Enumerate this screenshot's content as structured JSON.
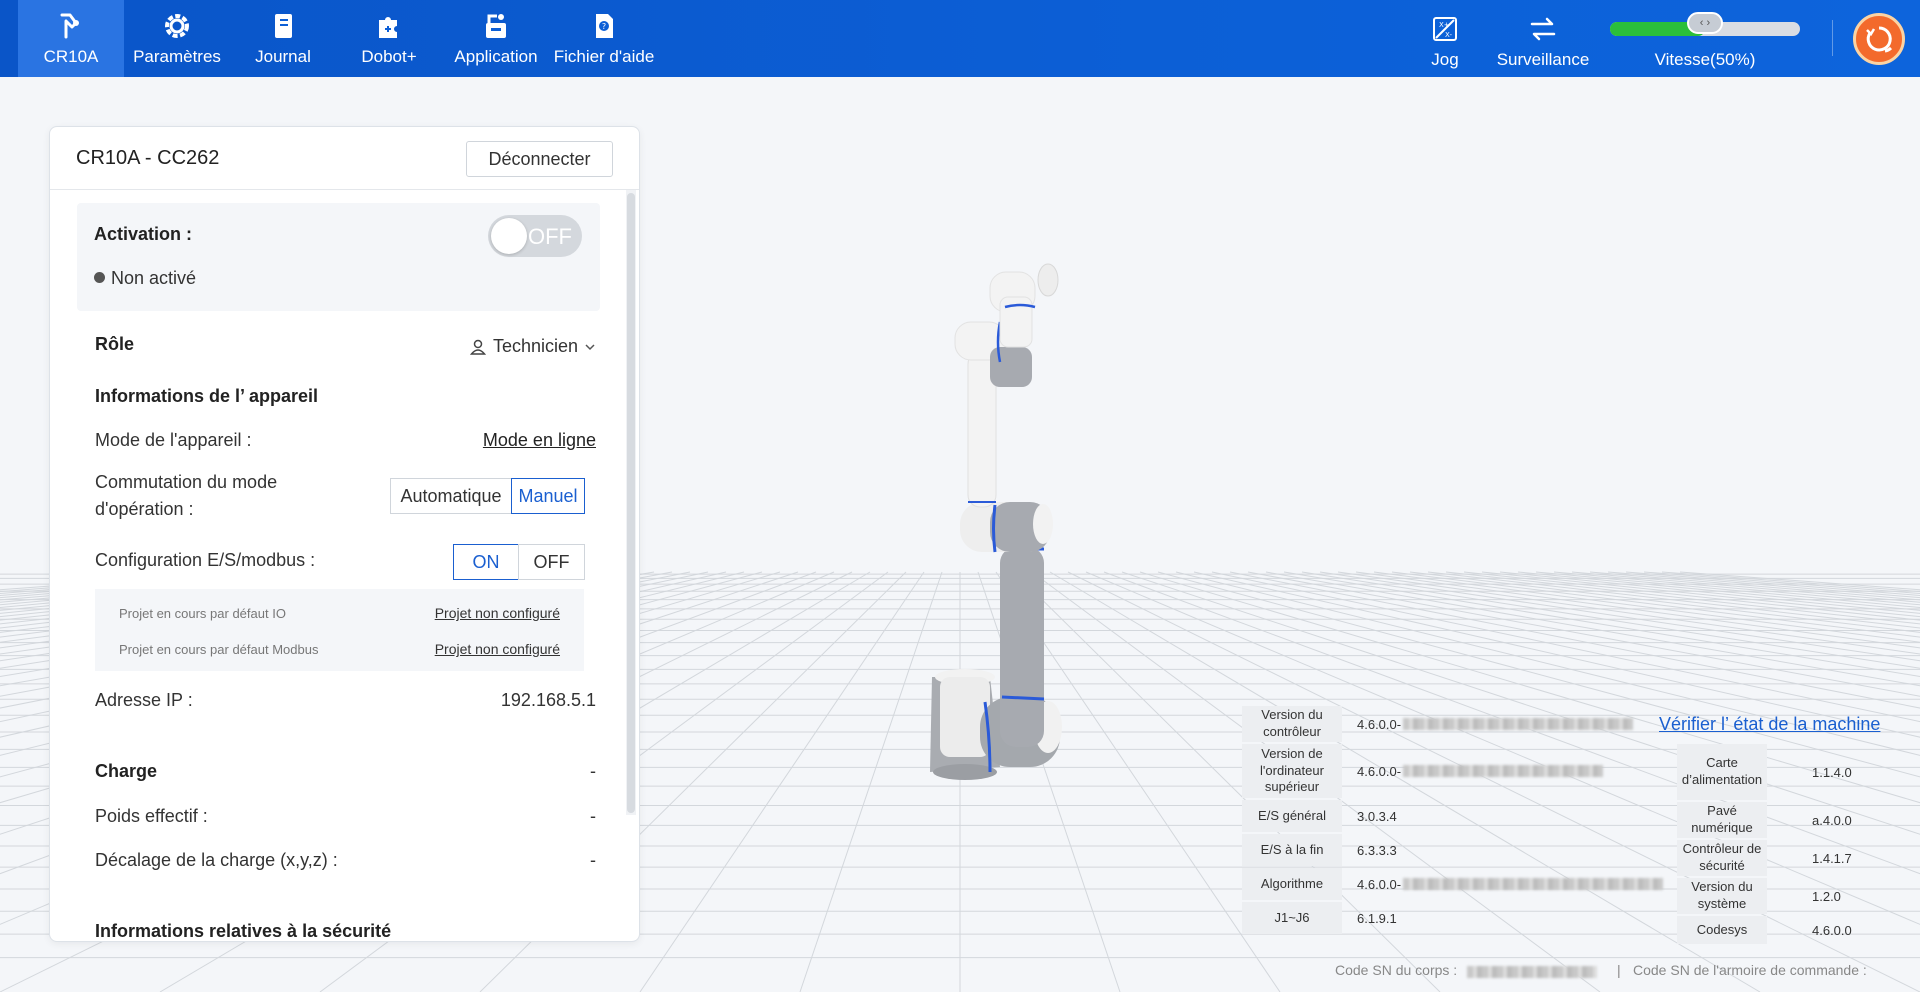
{
  "nav": {
    "items": [
      {
        "label": "CR10A",
        "icon": "robot-arm-icon",
        "active": true
      },
      {
        "label": "Paramètres",
        "icon": "gear-icon",
        "active": false
      },
      {
        "label": "Journal",
        "icon": "notebook-icon",
        "active": false
      },
      {
        "label": "Dobot+",
        "icon": "puzzle-icon",
        "active": false
      },
      {
        "label": "Application",
        "icon": "application-icon",
        "active": false
      },
      {
        "label": "Fichier d'aide",
        "icon": "help-file-icon",
        "active": false
      }
    ],
    "jog_label": "Jog",
    "surveillance_label": "Surveillance",
    "speed_label": "Vitesse(50%)",
    "speed_value": 0.5,
    "speed_knob_glyph": "‹ ›"
  },
  "panel": {
    "title": "CR10A - CC262",
    "disconnect_label": "Déconnecter",
    "activation_label": "Activation :",
    "activation_toggle": "OFF",
    "activation_status": "Non activé",
    "role_label": "Rôle",
    "role_value": "Technicien",
    "device_info_heading": "Informations de l’ appareil",
    "device_mode_label": "Mode de l'appareil :",
    "device_mode_value": "Mode en ligne",
    "op_mode_label_1": "Commutation du mode",
    "op_mode_label_2": "d'opération :",
    "op_mode_auto": "Automatique",
    "op_mode_manual": "Manuel",
    "io_config_label": "Configuration E/S/modbus :",
    "io_on": "ON",
    "io_off": "OFF",
    "io_project_label": "Projet en cours par défaut IO",
    "io_project_value": "Projet non configuré",
    "modbus_project_label": "Projet en cours par défaut Modbus",
    "modbus_project_value": "Projet non configuré",
    "ip_label": "Adresse IP :",
    "ip_value": "192.168.5.1",
    "charge_heading": "Charge",
    "charge_value": "-",
    "weight_label": "Poids effectif :",
    "weight_value": "-",
    "offset_label": "Décalage de la charge (x,y,z) :",
    "offset_value": "-",
    "security_heading": "Informations relatives à la sécurité"
  },
  "versions": {
    "verify_link": "Vérifier l’ état de la machine",
    "left": [
      {
        "label": "Version du contrôleur",
        "value": "4.6.0.0-"
      },
      {
        "label": "Version de l'ordinateur supérieur",
        "value": "4.6.0.0-"
      },
      {
        "label": "E/S général",
        "value": "3.0.3.4"
      },
      {
        "label": "E/S à la fin",
        "value": "6.3.3.3"
      },
      {
        "label": "Algorithme",
        "value": "4.6.0.0-"
      },
      {
        "label": "J1~J6",
        "value": "6.1.9.1"
      }
    ],
    "right": [
      {
        "label": "Carte d’alimentation",
        "value": "1.1.4.0"
      },
      {
        "label": "Pavé numérique",
        "value": "a.4.0.0"
      },
      {
        "label": "Contrôleur de sécurité",
        "value": "1.4.1.7"
      },
      {
        "label": "Version du système",
        "value": "1.2.0"
      },
      {
        "label": "Codesys",
        "value": "4.6.0.0"
      }
    ],
    "sn_body_label": "Code SN du corps :",
    "sn_separator": "|",
    "sn_cabinet_label": "Code SN de l'armoire de commande :"
  }
}
